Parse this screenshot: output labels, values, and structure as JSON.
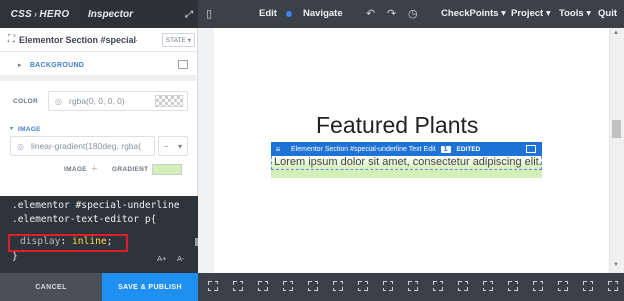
{
  "topbar": {
    "brand_left": "CSS",
    "brand_sep": "›",
    "brand_right": "HERO",
    "inspector": "Inspector",
    "edit": "Edit",
    "navigate": "Navigate",
    "menus": [
      "CheckPoints",
      "Project",
      "Tools"
    ],
    "quit": "Quit",
    "icons": [
      "expand-icon",
      "mobile-icon",
      "undo-icon",
      "redo-icon",
      "history-icon"
    ]
  },
  "panel": {
    "title": "Elementor Section #special-underline",
    "state": "STATE",
    "background_label": "BACKGROUND",
    "color_label": "COLOR",
    "color_value": "rgba(0, 0, 0, 0)",
    "image_label": "IMAGE",
    "image_value": "linear-gradient(180deg, rgba(",
    "image_sub": "IMAGE",
    "gradient_sub": "GRADIENT",
    "gradient_swatch_color": "#d4efb7"
  },
  "code": {
    "line1": ".elementor #special-underline",
    "line2": ".elementor-text-editor p{",
    "prop": "display",
    "value": "inline",
    "close": "}",
    "font_up": "A+",
    "font_down": "A-"
  },
  "footer": {
    "cancel": "CANCEL",
    "save": "SAVE & PUBLISH"
  },
  "preview": {
    "heading": "Featured Plants",
    "tag": "Elementor Section #special-underline Text Edit",
    "tag_count": "1",
    "tag_edited": "EDITED",
    "lorem": "Lorem ipsum dolor sit amet, consectetur adipiscing elit."
  },
  "colors": {
    "accent": "#1f73d6",
    "highlight_border": "#e11d2a",
    "gradient_green": "#d4efb7"
  }
}
